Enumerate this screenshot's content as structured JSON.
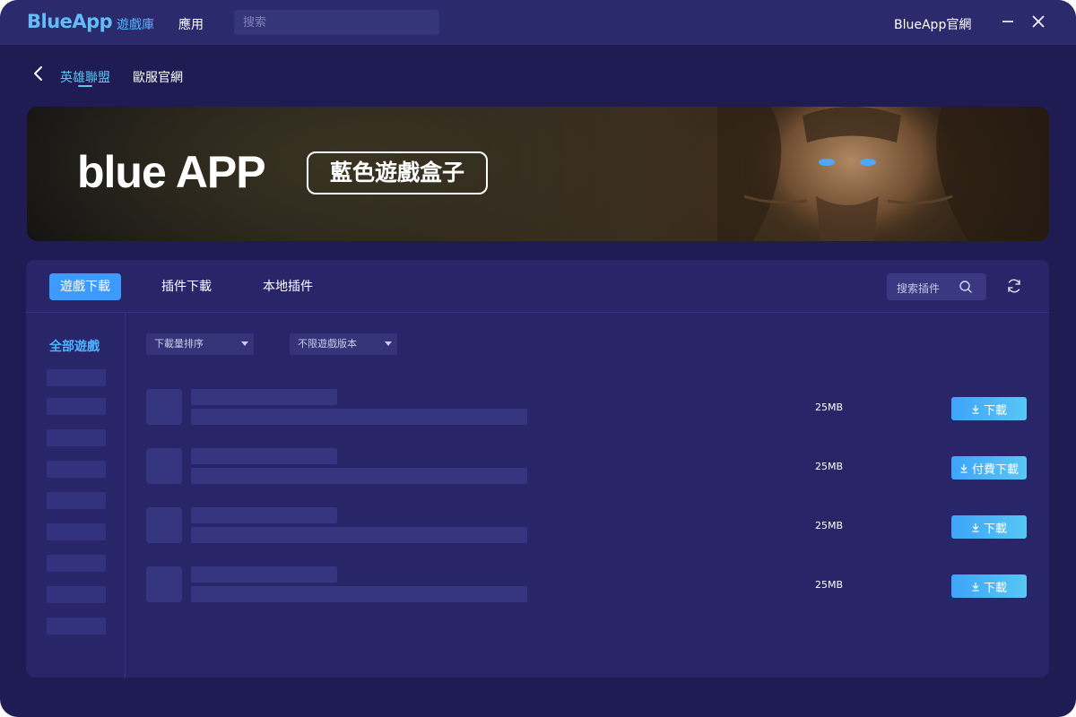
{
  "titlebar": {
    "logo": "BlueApp",
    "nav": [
      "遊戲庫",
      "應用"
    ],
    "search_placeholder": "搜索",
    "site_link": "BlueApp官網"
  },
  "subnav": {
    "tabs": [
      "英雄聯盟",
      "歐服官網"
    ]
  },
  "banner": {
    "brand": "blue APP",
    "tagline": "藍色遊戲盒子"
  },
  "panel": {
    "tabs": [
      "遊戲下載",
      "插件下載",
      "本地插件"
    ],
    "plugin_search_placeholder": "搜索插件",
    "sidebar_label": "全部遊戲",
    "filters": {
      "sort": "下載量排序",
      "version": "不限遊戲版本"
    },
    "games": [
      {
        "size": "25MB",
        "button": "下載"
      },
      {
        "size": "25MB",
        "button": "付費下載"
      },
      {
        "size": "25MB",
        "button": "下載"
      },
      {
        "size": "25MB",
        "button": "下載"
      }
    ]
  },
  "colors": {
    "accent": "#3d9bff",
    "background": "#1e1c52",
    "panel": "#282669"
  }
}
